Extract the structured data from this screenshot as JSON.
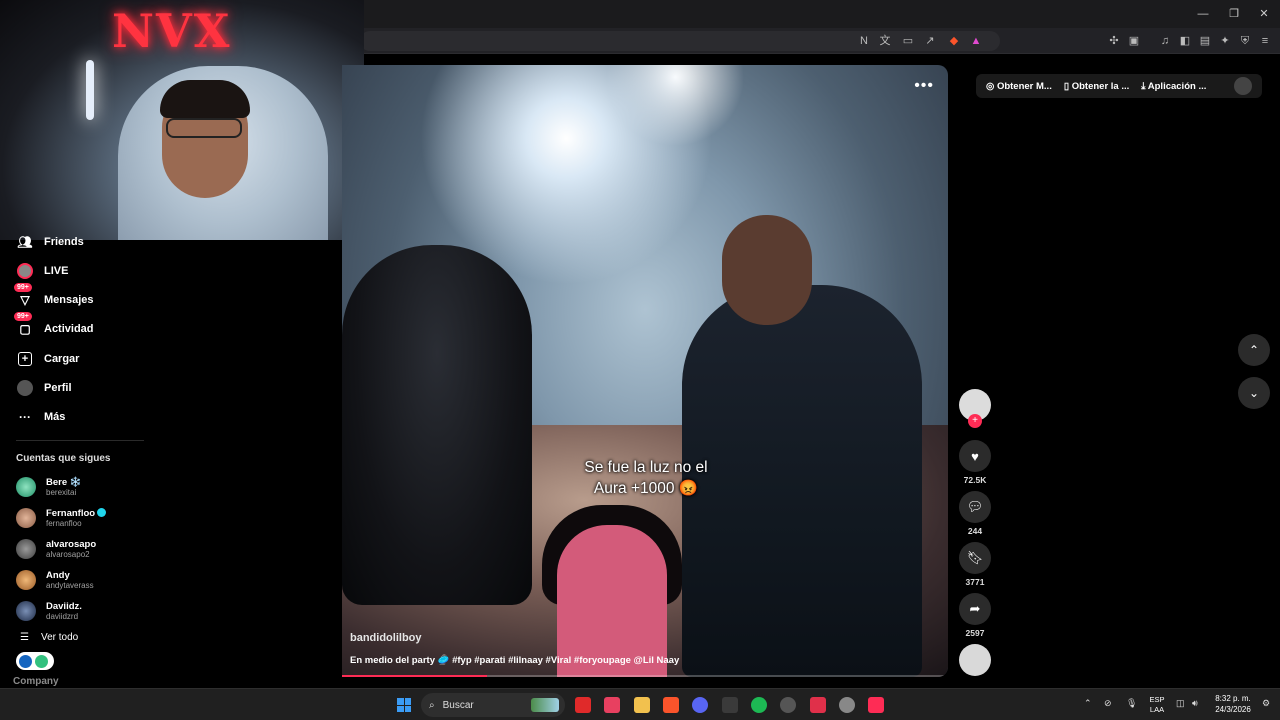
{
  "webcam": {
    "neon_sign": "NVX"
  },
  "sidebar": {
    "nav": [
      {
        "label": "Friends",
        "icon": "friends-icon"
      },
      {
        "label": "LIVE",
        "icon": "live-icon"
      },
      {
        "label": "Mensajes",
        "icon": "messages-icon",
        "badge": "99+"
      },
      {
        "label": "Actividad",
        "icon": "activity-icon",
        "badge": "99+"
      },
      {
        "label": "Cargar",
        "icon": "upload-icon"
      },
      {
        "label": "Perfil",
        "icon": "profile-icon"
      },
      {
        "label": "Más",
        "icon": "more-icon"
      }
    ],
    "following_title": "Cuentas que sigues",
    "following": [
      {
        "name": "Bere ❄️",
        "username": "berexitai",
        "color": "#2fae7a"
      },
      {
        "name": "Fernanfloo",
        "username": "fernanfloo",
        "verified": true,
        "color": "#b07a5e"
      },
      {
        "name": "alvarosapo",
        "username": "alvarosapo2",
        "color": "#6b6b6b"
      },
      {
        "name": "Andy",
        "username": "andytaverass",
        "color": "#c98a4c"
      },
      {
        "name": "Daviidz.",
        "username": "daviidzrd",
        "color": "#3b4d6e"
      }
    ],
    "see_all": "Ver todo",
    "company": "Company"
  },
  "video": {
    "caption_line1": "Se fue la luz no el",
    "caption_line2": "Aura +1000 😡",
    "author": "bandidolilboy",
    "description": "En medio del party 🥏 #fyp #parati #lilnaay #Viral #foryoupage @Lil  Naay",
    "progress_percent": 24
  },
  "actions": {
    "likes": "72.5K",
    "comments": "244",
    "saves": "3771",
    "shares": "2597"
  },
  "top_links": {
    "coins": "Obtener M...",
    "app": "Obtener la ...",
    "download": "Aplicación ..."
  },
  "taskbar": {
    "search_placeholder": "Buscar",
    "lang_line1": "ESP",
    "lang_line2": "LAA",
    "time": "8:32 p. m.",
    "date": "24/3/2026"
  },
  "colors": {
    "accent": "#fe2c55",
    "verified": "#20d5ec"
  }
}
